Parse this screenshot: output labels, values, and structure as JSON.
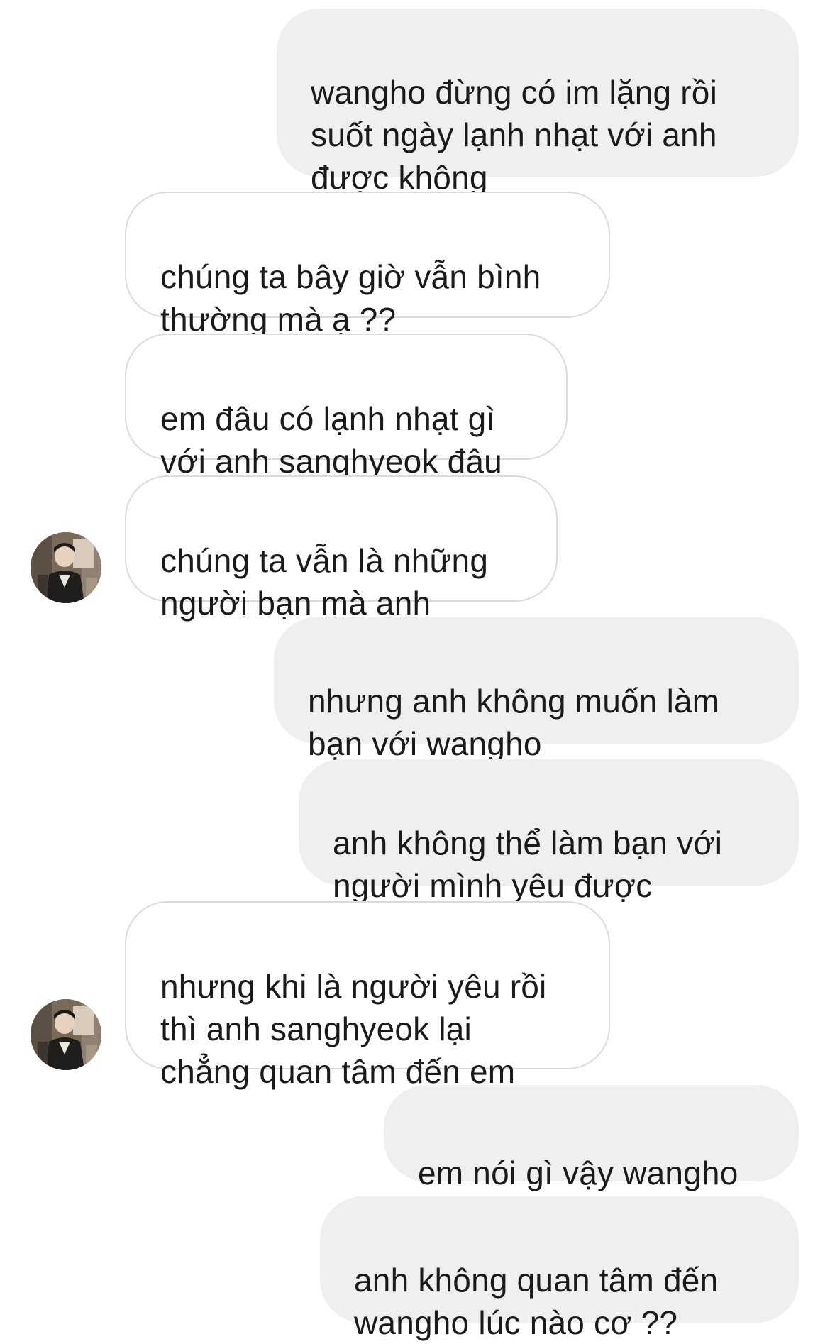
{
  "messages": [
    {
      "side": "sent",
      "text": "wangho đừng có im lặng rồi\nsuốt ngày lạnh nhạt với anh\nđược không"
    },
    {
      "side": "received",
      "text": "chúng ta bây giờ vẫn bình\nthường mà ạ ??"
    },
    {
      "side": "received",
      "text": "em đâu có lạnh nhạt gì\nvới anh sanghyeok đâu"
    },
    {
      "side": "received",
      "text": "chúng ta vẫn là những\nngười bạn mà anh",
      "avatar": true
    },
    {
      "side": "sent",
      "text": "nhưng anh không muốn làm\nbạn với wangho"
    },
    {
      "side": "sent",
      "text": "anh không thể làm bạn với\nngười mình yêu được"
    },
    {
      "side": "received",
      "text": "nhưng khi là người yêu rồi\nthì anh sanghyeok lại\nchẳng quan tâm đến em",
      "avatar": true
    },
    {
      "side": "sent",
      "text": "em nói gì vậy wangho"
    },
    {
      "side": "sent",
      "text": "anh không quan tâm đến\nwangho lúc nào cơ ??"
    }
  ],
  "colors": {
    "sent_bubble": "#efefef",
    "received_bubble": "#ffffff",
    "received_border": "#dbdbdb",
    "text": "#1a1a1a"
  },
  "icons": {
    "avatar": "profile-photo-icon"
  }
}
